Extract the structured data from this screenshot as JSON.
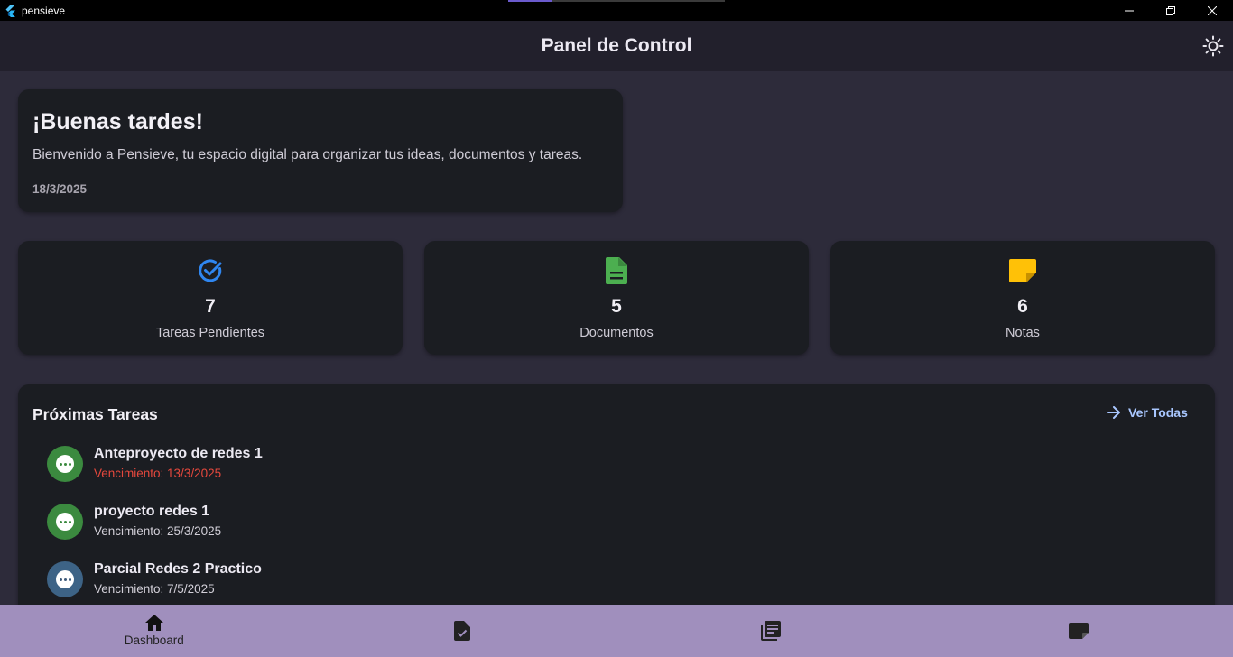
{
  "window": {
    "app_name": "pensieve",
    "controls": [
      "minimize",
      "restore",
      "close"
    ]
  },
  "appbar": {
    "title": "Panel de Control",
    "theme_icon": "sun-icon"
  },
  "welcome": {
    "greeting": "¡Buenas tardes!",
    "message": "Bienvenido a Pensieve, tu espacio digital para organizar tus ideas, documentos y tareas.",
    "date": "18/3/2025"
  },
  "stats": [
    {
      "icon": "check-circle-icon",
      "value": "7",
      "label": "Tareas Pendientes",
      "color": "#2f86f0"
    },
    {
      "icon": "document-icon",
      "value": "5",
      "label": "Documentos",
      "color": "#4caf50"
    },
    {
      "icon": "note-icon",
      "value": "6",
      "label": "Notas",
      "color": "#ffc107"
    }
  ],
  "tasks": {
    "heading": "Próximas Tareas",
    "see_all": "Ver Todas",
    "items": [
      {
        "name": "Anteproyecto de redes 1",
        "due": "Vencimiento: 13/3/2025",
        "overdue": true,
        "avatar_color": "#3b8a3f"
      },
      {
        "name": "proyecto redes 1",
        "due": "Vencimiento: 25/3/2025",
        "overdue": false,
        "avatar_color": "#3b8a3f"
      },
      {
        "name": "Parcial Redes 2 Practico",
        "due": "Vencimiento: 7/5/2025",
        "overdue": false,
        "avatar_color": "#3d6386"
      }
    ]
  },
  "bottom_nav": {
    "items": [
      {
        "icon": "home-icon",
        "label": "Dashboard",
        "active": true
      },
      {
        "icon": "task-icon",
        "label": "",
        "active": false
      },
      {
        "icon": "library-icon",
        "label": "",
        "active": false
      },
      {
        "icon": "note-icon",
        "label": "",
        "active": false
      }
    ]
  },
  "colors": {
    "background": "#2d2b3a",
    "card": "#1b1d22",
    "appbar": "#22202c",
    "bottom_nav": "#a08fbd",
    "overdue": "#e5483d",
    "link": "#a9c7ff"
  }
}
